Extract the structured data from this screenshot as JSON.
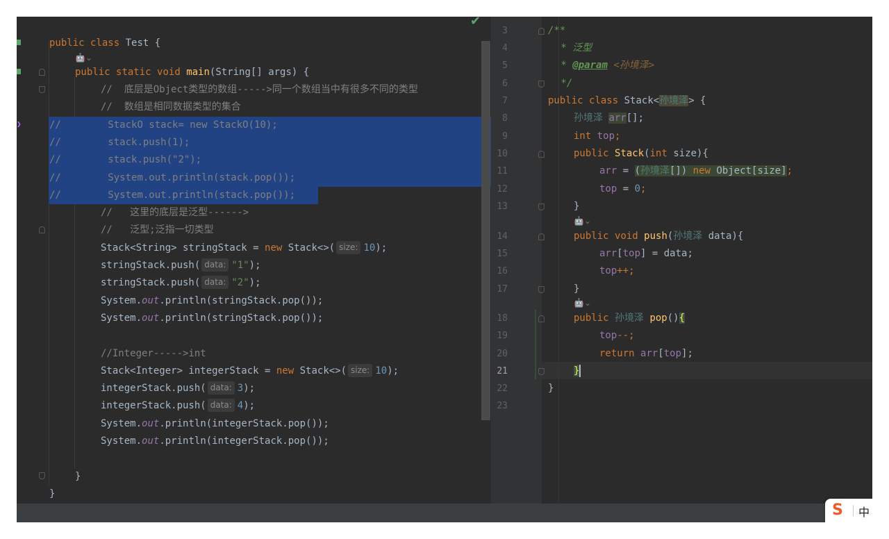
{
  "left_editor": {
    "lines": [
      {
        "kind": "class_decl",
        "kw1": "public",
        "kw2": "class",
        "name": "Test",
        "brace": "{"
      },
      {
        "kind": "ai_hint",
        "text": "🤖⌄"
      },
      {
        "kind": "main_decl",
        "kw1": "public",
        "kw2": "static",
        "kw3": "void",
        "fn": "main",
        "params": "(String[] args) {"
      },
      {
        "kind": "comment",
        "text": "//  底层是Object类型的数组----->同一个数组当中有很多不同的类型"
      },
      {
        "kind": "comment",
        "text": "//  数组是相同数据类型的集合"
      },
      {
        "kind": "sel_comment",
        "prefix": "//",
        "text": "StackO stack= new StackO(10);"
      },
      {
        "kind": "sel_comment",
        "prefix": "//",
        "text": "stack.push(1);"
      },
      {
        "kind": "sel_comment",
        "prefix": "//",
        "text": "stack.push(\"2\");"
      },
      {
        "kind": "sel_comment",
        "prefix": "//",
        "text": "System.out.println(stack.pop());"
      },
      {
        "kind": "sel_comment",
        "prefix": "//",
        "text": "System.out.println(stack.pop());"
      },
      {
        "kind": "comment",
        "text": "//   这里的底层是泛型------>"
      },
      {
        "kind": "comment",
        "text": "//   泛型;泛指一切类型"
      }
    ],
    "stack_string_decl": {
      "type": "Stack<String> stringStack = ",
      "new": "new",
      "ctor": " Stack<>(",
      "hint": "size:",
      "num": "10",
      "end": ");"
    },
    "push1": {
      "call": "stringStack.push(",
      "hint": "data:",
      "val": "\"1\"",
      "end": ");"
    },
    "push2": {
      "call": "stringStack.push(",
      "hint": "data:",
      "val": "\"2\"",
      "end": ");"
    },
    "print1": {
      "pre": "System.",
      "out": "out",
      "post": ".println(stringStack.pop());"
    },
    "print2": {
      "pre": "System.",
      "out": "out",
      "post": ".println(stringStack.pop());"
    },
    "int_comment": "//Integer----->int",
    "stack_int_decl": {
      "type": "Stack<Integer> integerStack = ",
      "new": "new",
      "ctor": " Stack<>(",
      "hint": "size:",
      "num": "10",
      "end": ");"
    },
    "push3": {
      "call": "integerStack.push(",
      "hint": "data:",
      "val": "3",
      "end": ");"
    },
    "push4": {
      "call": "integerStack.push(",
      "hint": "data:",
      "val": "4",
      "end": ");"
    },
    "print3": {
      "pre": "System.",
      "out": "out",
      "post": ".println(integerStack.pop());"
    },
    "print4": {
      "pre": "System.",
      "out": "out",
      "post": ".println(integerStack.pop());"
    },
    "close_method": "}",
    "close_class": "}",
    "status_check": "✔"
  },
  "right_editor": {
    "line_numbers": [
      "3",
      "4",
      "5",
      "6",
      "7",
      "8",
      "9",
      "10",
      "11",
      "12",
      "13",
      "14",
      "15",
      "16",
      "17",
      "18",
      "19",
      "20",
      "21",
      "22",
      "23"
    ],
    "doc_open": "/**",
    "doc_line1": " * 泛型",
    "doc_tag": "@param",
    "doc_val": "<孙境泽>",
    "doc_close": " */",
    "class_decl": {
      "kw1": "public",
      "kw2": "class",
      "name": "Stack<",
      "tparam": "孙境泽",
      "end": "> {"
    },
    "field_arr": {
      "type": "孙境泽",
      "name": "arr",
      "end": "[];"
    },
    "field_top": {
      "kw": "int",
      "name": "top",
      "end": ";"
    },
    "ctor": {
      "kw": "public",
      "name": "Stack",
      "p1": "(",
      "kw2": "int",
      "p2": " size){"
    },
    "ctor_body1": {
      "name": "arr",
      "eq": " = ",
      "cast_open": "(",
      "tparam": "孙境泽",
      "cast_close": "[]) ",
      "new": "new",
      "rest": " Object[size]",
      ";": ";"
    },
    "ctor_body2": {
      "name": "top",
      "eq": " = ",
      "num": "0",
      "end": ";"
    },
    "close1": "}",
    "ai1": "🤖⌄",
    "push_decl": {
      "kw1": "public",
      "kw2": "void",
      "name": "push",
      "p1": "(",
      "tparam": "孙境泽",
      "p2": " data){"
    },
    "push_body1": {
      "name": "arr",
      "b1": "[",
      "name2": "top",
      "b2": "] = data;"
    },
    "push_body2": {
      "name": "top",
      "end": "++;"
    },
    "close2": "}",
    "ai2": "🤖⌄",
    "pop_decl": {
      "kw1": "public",
      "tparam": "孙境泽",
      "name": "pop",
      "p": "()",
      "brace": "{"
    },
    "pop_body1": {
      "name": "top",
      "end": "--;"
    },
    "pop_body2": {
      "kw": "return",
      "name": "arr",
      "b1": "[",
      "name2": "top",
      "b2": "];"
    },
    "close3": "}",
    "close_class": "}"
  },
  "ime": {
    "logo": "S",
    "label": "中"
  }
}
